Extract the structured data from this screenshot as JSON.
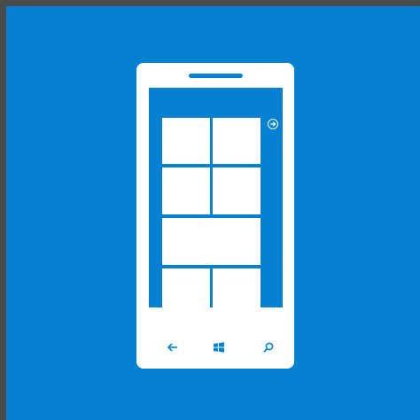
{
  "icon": {
    "name": "windows-phone-icon",
    "colors": {
      "background": "#0482d1",
      "device": "#ffffff",
      "frame": "#4a4a4a"
    },
    "start_screen": {
      "tiles": [
        "small",
        "small",
        "small",
        "small",
        "wide",
        "small",
        "small"
      ]
    },
    "hardware_buttons": [
      "back-icon",
      "windows-start-icon",
      "search-icon"
    ],
    "screen_icons": [
      "arrow-circle-icon"
    ]
  }
}
